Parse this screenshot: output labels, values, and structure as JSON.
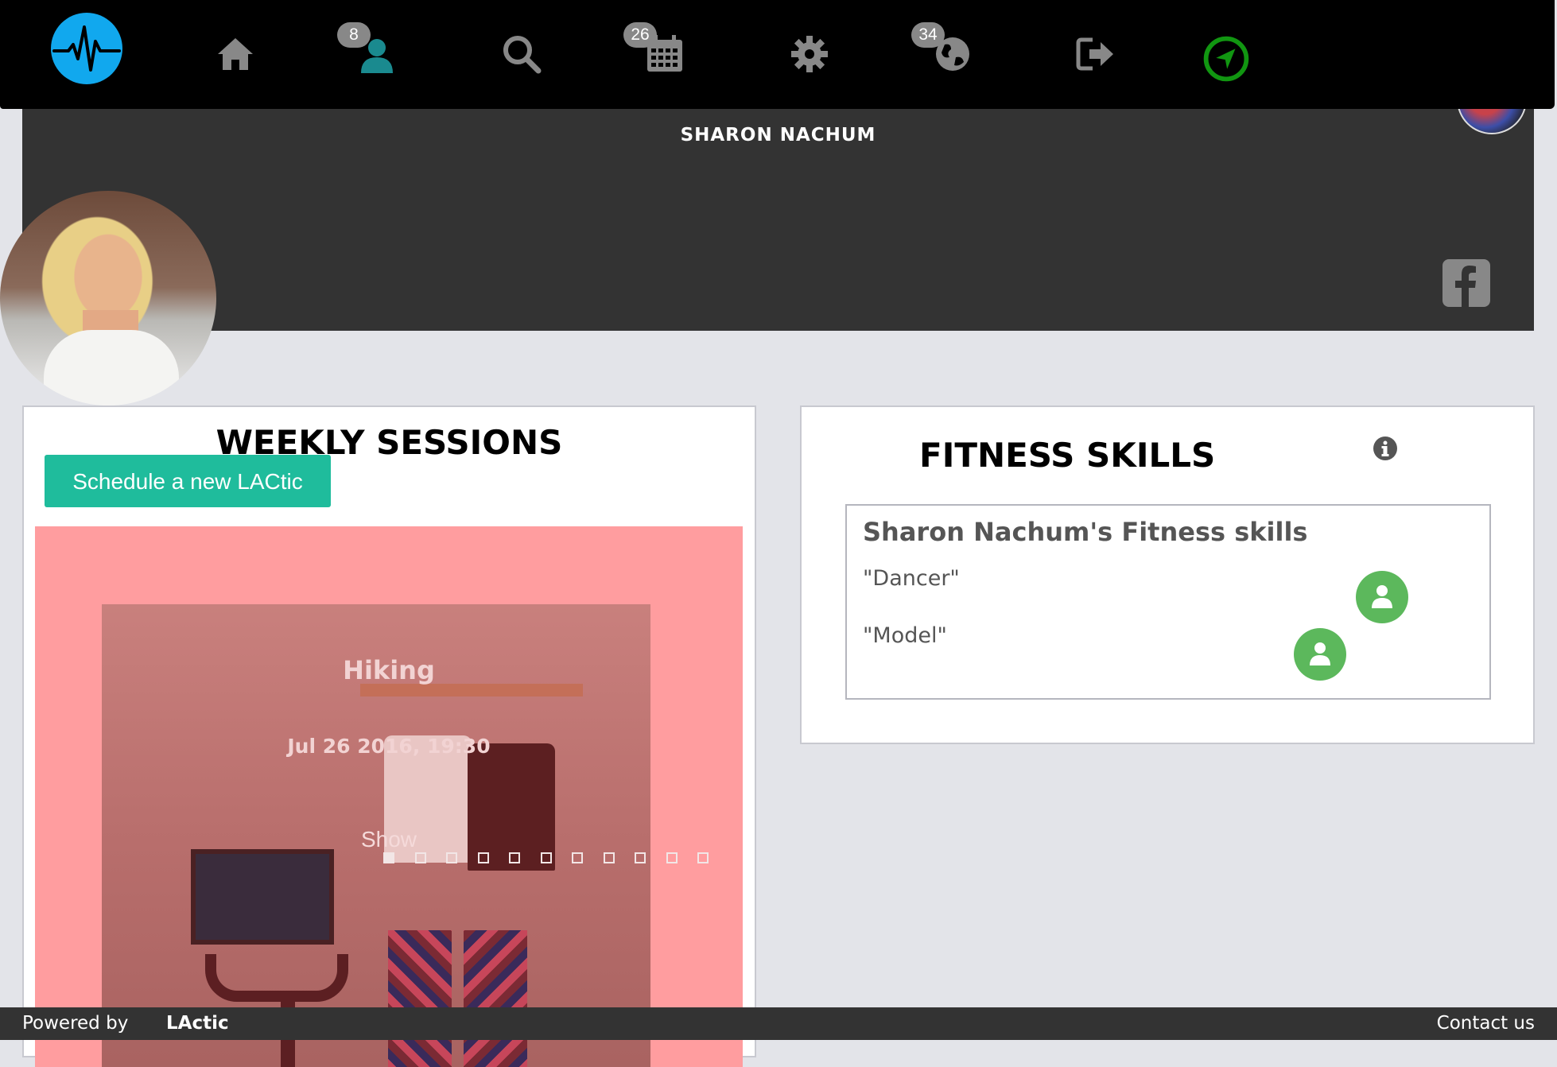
{
  "navbar": {
    "items": [
      {
        "name": "home",
        "badge": ""
      },
      {
        "name": "friends",
        "badge": "8"
      },
      {
        "name": "search",
        "badge": ""
      },
      {
        "name": "calendar",
        "badge": "26"
      },
      {
        "name": "settings",
        "badge": ""
      },
      {
        "name": "globe",
        "badge": "34"
      },
      {
        "name": "logout",
        "badge": ""
      },
      {
        "name": "navigate",
        "badge": ""
      }
    ],
    "colors": {
      "logo": "#11a8ee",
      "icon": "#888888",
      "friends_icon": "#1a8a8f",
      "navigate": "#119611"
    }
  },
  "profile": {
    "name": "SHARON NACHUM"
  },
  "weekly_sessions": {
    "title": "WEEKLY SESSIONS",
    "schedule_button": "Schedule a new LACtic",
    "session": {
      "name": "Hiking",
      "date": "Jul 26 2016, 19:30",
      "action": "Show"
    },
    "carousel": {
      "total_slides": 11,
      "active_index": 0
    }
  },
  "fitness_skills": {
    "title": "FITNESS SKILLS",
    "heading": "Sharon Nachum's Fitness skills",
    "skills": [
      {
        "label": "\"Dancer\""
      },
      {
        "label": "\"Model\""
      }
    ]
  },
  "footer": {
    "powered_by": "Powered by",
    "brand": "LActic",
    "contact": "Contact us"
  }
}
